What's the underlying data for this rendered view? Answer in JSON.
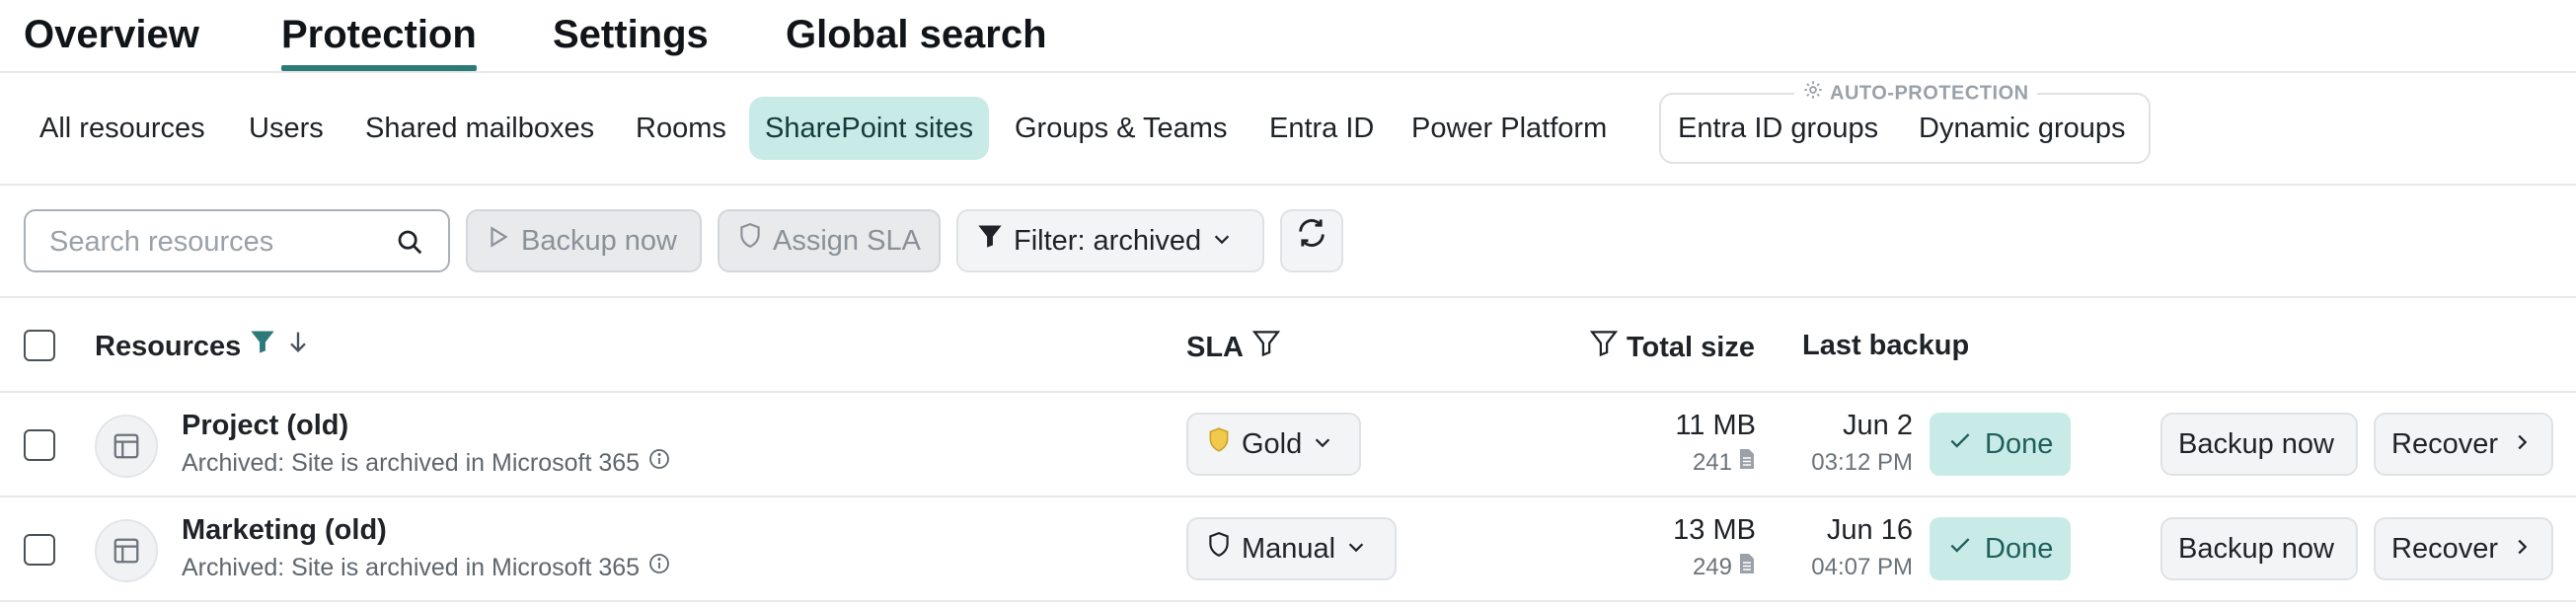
{
  "top_tabs": [
    {
      "label": "Overview",
      "active": false
    },
    {
      "label": "Protection",
      "active": true
    },
    {
      "label": "Settings",
      "active": false
    },
    {
      "label": "Global search",
      "active": false
    }
  ],
  "sub_nav": {
    "items": [
      {
        "label": "All resources",
        "active": false
      },
      {
        "label": "Users",
        "active": false
      },
      {
        "label": "Shared mailboxes",
        "active": false
      },
      {
        "label": "Rooms",
        "active": false
      },
      {
        "label": "SharePoint sites",
        "active": true
      },
      {
        "label": "Groups & Teams",
        "active": false
      },
      {
        "label": "Entra ID",
        "active": false
      },
      {
        "label": "Power Platform",
        "active": false
      }
    ],
    "auto_protection": {
      "caption": "AUTO-PROTECTION",
      "items": [
        {
          "label": "Entra ID groups"
        },
        {
          "label": "Dynamic groups"
        }
      ]
    }
  },
  "toolbar": {
    "search_placeholder": "Search resources",
    "backup_now_label": "Backup now",
    "assign_sla_label": "Assign SLA",
    "filter_label": "Filter: archived"
  },
  "table": {
    "headers": {
      "resources": "Resources",
      "sla": "SLA",
      "total_size": "Total size",
      "last_backup": "Last backup"
    },
    "rows": [
      {
        "name": "Project (old)",
        "subtitle": "Archived: Site is archived in Microsoft 365",
        "sla": "Gold",
        "sla_icon": "gold-shield-icon",
        "size": "11 MB",
        "files": "241",
        "date": "Jun 2",
        "time": "03:12 PM",
        "status": "Done",
        "backup_label": "Backup now",
        "recover_label": "Recover"
      },
      {
        "name": "Marketing (old)",
        "subtitle": "Archived: Site is archived in Microsoft 365",
        "sla": "Manual",
        "sla_icon": "shield-outline-icon",
        "size": "13 MB",
        "files": "249",
        "date": "Jun 16",
        "time": "04:07 PM",
        "status": "Done",
        "backup_label": "Backup now",
        "recover_label": "Recover"
      }
    ]
  },
  "colors": {
    "accent": "#2c7a78",
    "active_pill": "#c9ebe7",
    "gold": "#f2c94c"
  }
}
